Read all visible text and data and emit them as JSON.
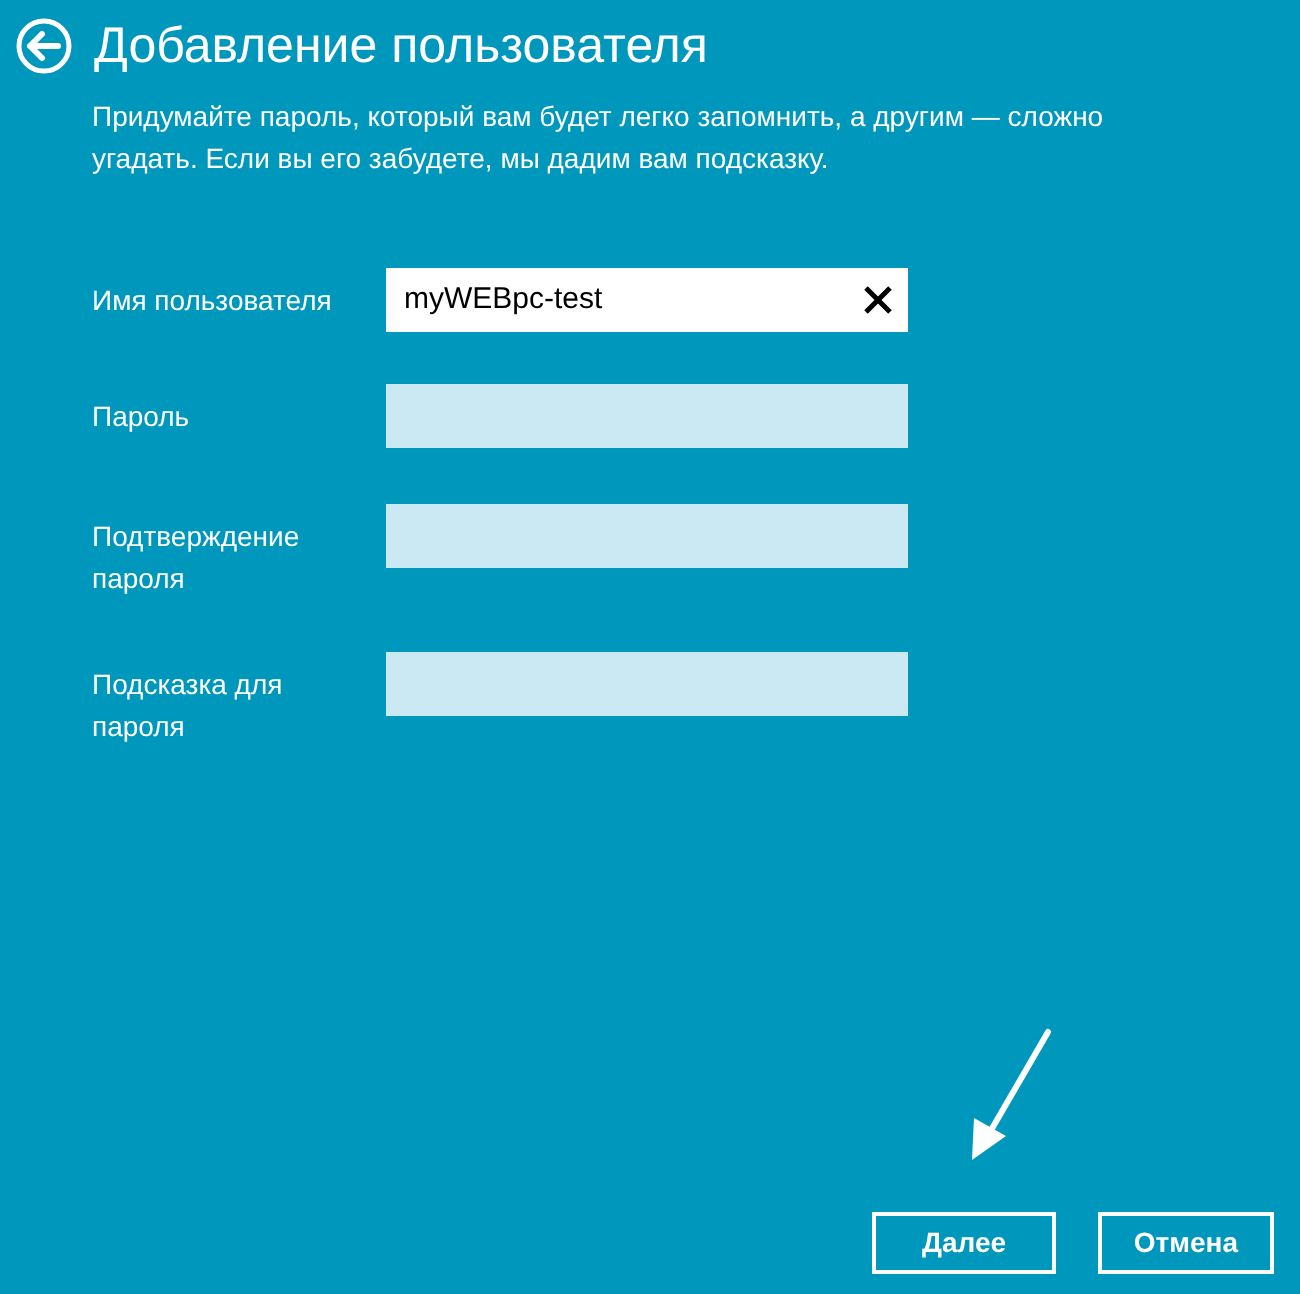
{
  "title": "Добавление пользователя",
  "description": "Придумайте пароль, который вам будет легко запомнить, а другим — сложно угадать. Если вы его забудете, мы дадим вам подсказку.",
  "fields": [
    {
      "label": "Имя пользователя",
      "value": "myWEBpc-test",
      "focused": true
    },
    {
      "label": "Пароль",
      "focused": false
    },
    {
      "label": "Подтверждение пароля",
      "focused": false
    },
    {
      "label": "Подсказка для пароля",
      "focused": false
    }
  ],
  "buttons": [
    "Далее",
    "Отмена"
  ]
}
